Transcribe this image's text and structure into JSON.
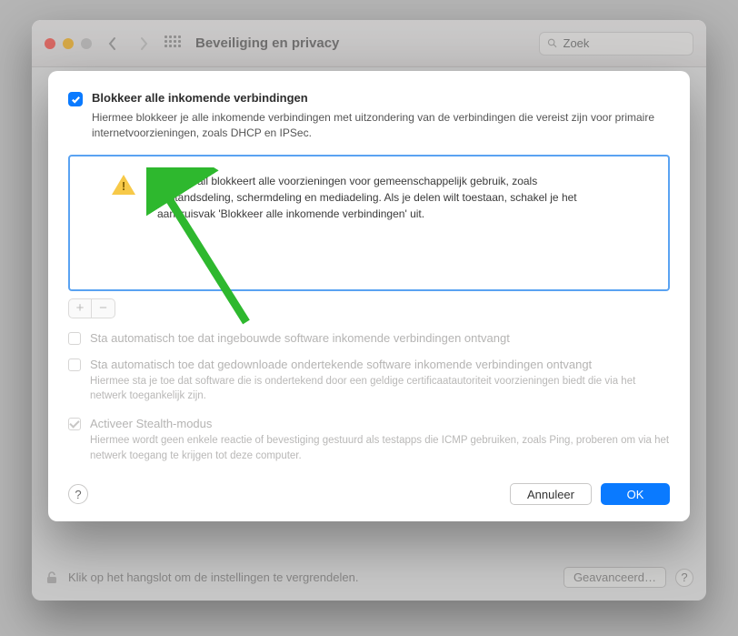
{
  "toolbar": {
    "title": "Beveiliging en privacy",
    "search_placeholder": "Zoek"
  },
  "sheet": {
    "block_all": {
      "label": "Blokkeer alle inkomende verbindingen",
      "description": "Hiermee blokkeer je alle inkomende verbindingen met uitzondering van de verbindingen die vereist zijn voor primaire internetvoorzieningen, zoals DHCP en IPSec."
    },
    "info": "De firewall blokkeert alle voorzieningen voor gemeenschappelijk gebruik, zoals bestandsdeling, schermdeling en mediadeling. Als je delen wilt toestaan, schakel je het aankruisvak 'Blokkeer alle inkomende verbindingen' uit.",
    "opt_builtin": {
      "label": "Sta automatisch toe dat ingebouwde software inkomende verbindingen ontvangt"
    },
    "opt_signed": {
      "label": "Sta automatisch toe dat gedownloade ondertekende software inkomende verbindingen ontvangt",
      "description": "Hiermee sta je toe dat software die is ondertekend door een geldige certificaatautoriteit voorzieningen biedt die via het netwerk toegankelijk zijn."
    },
    "opt_stealth": {
      "label": "Activeer Stealth-modus",
      "description": "Hiermee wordt geen enkele reactie of bevestiging gestuurd als testapps die ICMP gebruiken, zoals Ping, proberen om via het netwerk toegang te krijgen tot deze computer."
    },
    "cancel": "Annuleer",
    "ok": "OK"
  },
  "lockbar": {
    "text": "Klik op het hangslot om de instellingen te vergrendelen.",
    "advanced": "Geavanceerd…"
  }
}
